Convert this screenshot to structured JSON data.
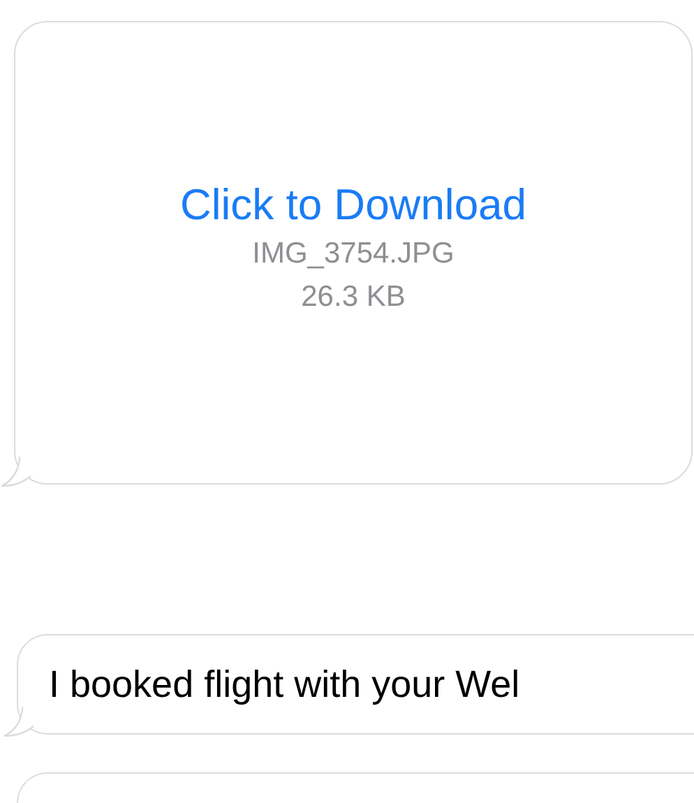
{
  "messages": [
    {
      "kind": "attachment",
      "link": "Click to Download",
      "filename": "IMG_3754.JPG",
      "size": "26.3 KB"
    },
    {
      "kind": "text",
      "text": "I booked flight with your Wel"
    },
    {
      "kind": "blank"
    }
  ]
}
